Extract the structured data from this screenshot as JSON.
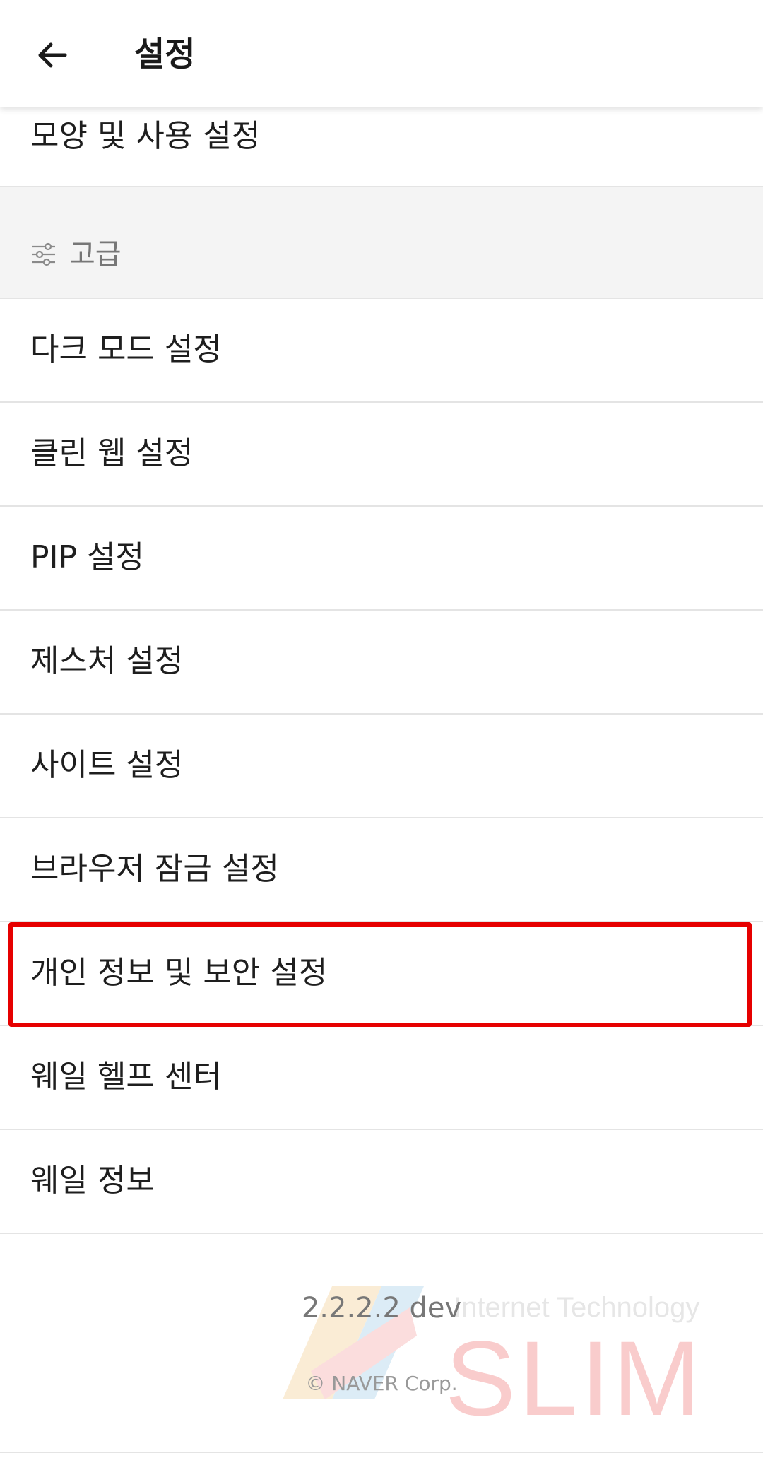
{
  "appbar": {
    "back_icon": "arrow-left-icon",
    "title": "설정"
  },
  "items_top": [
    {
      "label": "모양 및 사용 설정"
    }
  ],
  "section": {
    "icon": "sliders-icon",
    "label": "고급"
  },
  "items": [
    {
      "label": "다크 모드 설정"
    },
    {
      "label": "클린 웹 설정"
    },
    {
      "label": "PIP 설정"
    },
    {
      "label": "제스처 설정"
    },
    {
      "label": "사이트 설정"
    },
    {
      "label": "브라우저 잠금 설정"
    },
    {
      "label": "개인 정보 및 보안 설정"
    },
    {
      "label": "웨일 헬프 센터"
    },
    {
      "label": "웨일 정보"
    }
  ],
  "highlight": {
    "color": "#e60000",
    "target": "개인 정보 및 보안 설정"
  },
  "footer": {
    "version": "2.2.2.2 dev",
    "copyright": "© NAVER Corp."
  },
  "watermark": {
    "line1": "Internet Technology",
    "line2": "SLIM"
  }
}
